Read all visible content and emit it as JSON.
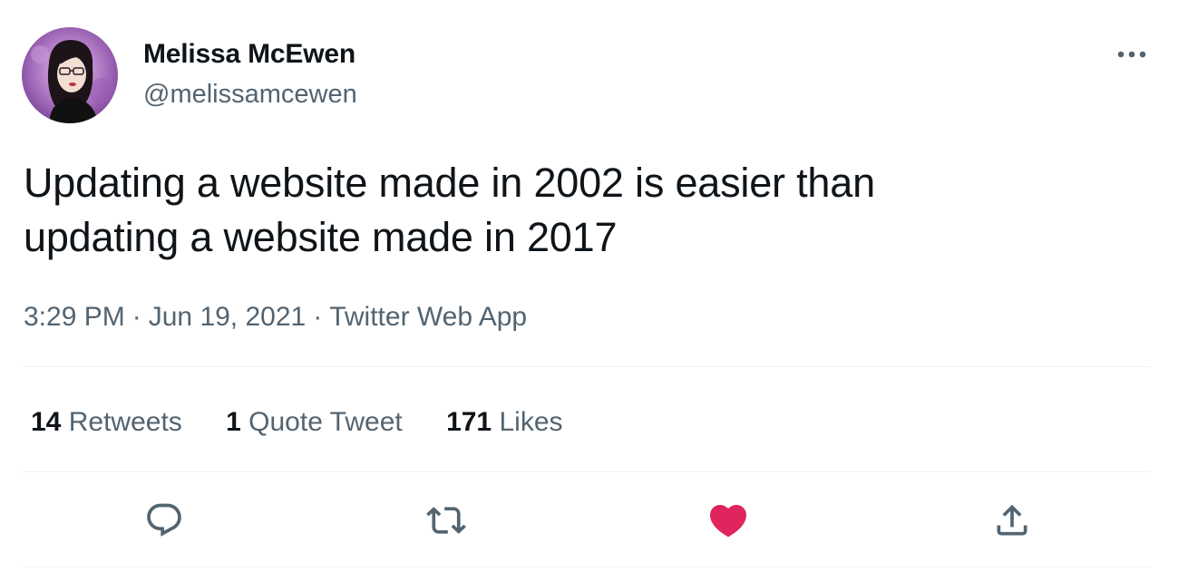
{
  "author": {
    "display_name": "Melissa McEwen",
    "handle": "@melissamcewen"
  },
  "tweet": {
    "text_line_1": "Updating a website made in 2002 is easier than",
    "text_line_2": "updating a website made in 2017"
  },
  "meta": {
    "time": "3:29 PM",
    "separator": "·",
    "date": "Jun 19, 2021",
    "source": "Twitter Web App"
  },
  "stats": {
    "retweets_count": "14",
    "retweets_label": "Retweets",
    "quotes_count": "1",
    "quotes_label": "Quote Tweet",
    "likes_count": "171",
    "likes_label": "Likes"
  },
  "icons": {
    "more": "more-horizontal-icon",
    "reply": "reply-icon",
    "retweet": "retweet-icon",
    "like": "heart-icon",
    "share": "share-icon"
  },
  "colors": {
    "text_primary": "#0f1419",
    "text_secondary": "#536471",
    "like_active": "#f91880",
    "icon_gray": "#536471",
    "divider": "#eff3f4"
  }
}
